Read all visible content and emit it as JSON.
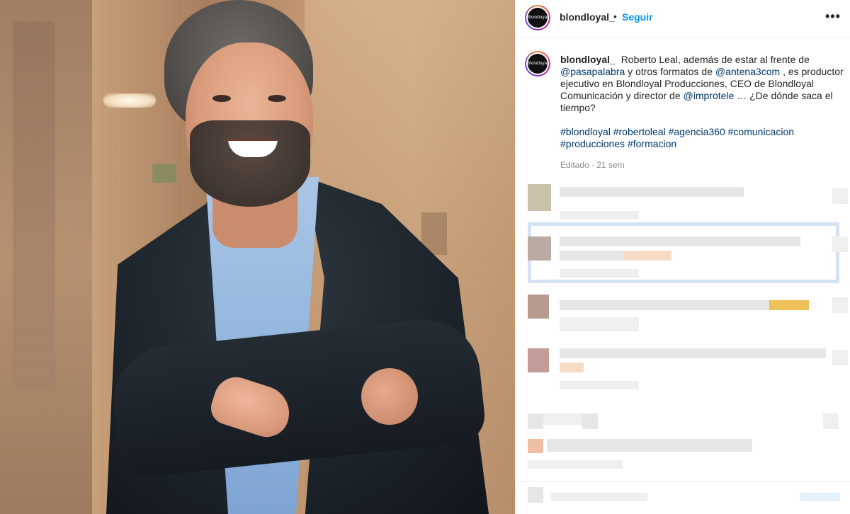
{
  "post": {
    "account": "blondloyal_",
    "avatar_text": "Blondloyal",
    "follow_label": "Seguir",
    "separator": "•",
    "more_icon": "•••"
  },
  "caption": {
    "username": "blondloyal_",
    "text_1": "Roberto Leal, además de estar al frente de",
    "mention_1": "@pasapalabra",
    "text_2": "y otros formatos de",
    "mention_2": "@antena3com",
    "text_3": ", es productor ejecutivo en Blondloyal Producciones, CEO de Blondloyal Comunicación y director de",
    "mention_3": "@improtele",
    "text_4": "… ¿De dónde saca el tiempo?",
    "hashtags": [
      "#blondloyal",
      "#robertoleal",
      "#agencia360",
      "#comunicacion",
      "#producciones",
      "#formacion"
    ],
    "edited": "Editado · 21 sem"
  },
  "colors": {
    "follow": "#0095f6",
    "link": "#00376b",
    "meta": "#8e8e8e"
  }
}
